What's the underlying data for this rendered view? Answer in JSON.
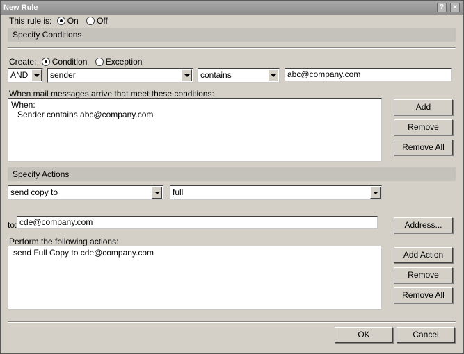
{
  "window": {
    "title": "New Rule",
    "help_glyph": "?",
    "close_glyph": "×"
  },
  "rule_status": {
    "label": "This rule is:",
    "on_label": "On",
    "off_label": "Off",
    "selected": "On"
  },
  "conditions": {
    "section_title": "Specify Conditions",
    "create_label": "Create:",
    "condition_label": "Condition",
    "exception_label": "Exception",
    "operator_value": "AND",
    "field_value": "sender",
    "comparison_value": "contains",
    "match_value": "abc@company.com",
    "list_label": "When mail messages arrive that meet these conditions:",
    "list_lines": [
      "When:",
      "Sender contains abc@company.com"
    ],
    "add_label": "Add",
    "remove_label": "Remove",
    "remove_all_label": "Remove All"
  },
  "actions": {
    "section_title": "Specify Actions",
    "action_value": "send copy to",
    "type_value": "full",
    "to_label": "to:",
    "to_value": "cde@company.com",
    "address_label": "Address...",
    "list_label": "Perform the following actions:",
    "list_lines": [
      "send Full Copy to cde@company.com"
    ],
    "add_action_label": "Add Action",
    "remove_label": "Remove",
    "remove_all_label": "Remove All"
  },
  "footer": {
    "ok_label": "OK",
    "cancel_label": "Cancel"
  }
}
